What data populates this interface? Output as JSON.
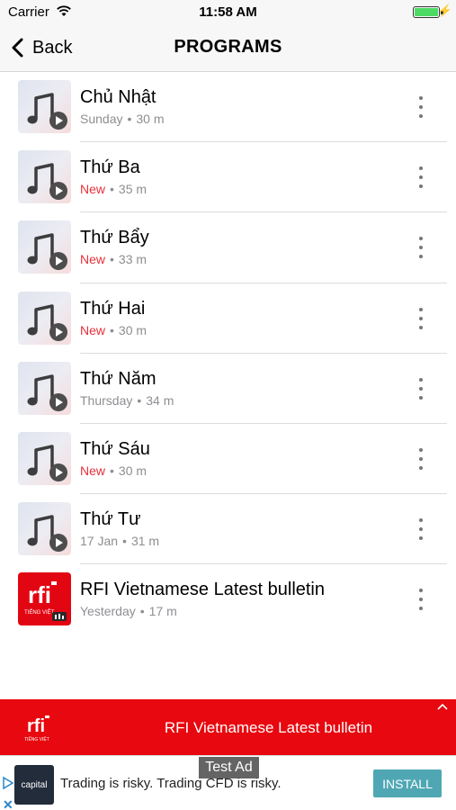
{
  "status_bar": {
    "carrier": "Carrier",
    "time": "11:58 AM"
  },
  "nav": {
    "back_label": "Back",
    "title": "PROGRAMS"
  },
  "programs": [
    {
      "title": "Chủ Nhật",
      "date": "Sunday",
      "is_new": false,
      "duration": "30 m",
      "thumb": "music-note-icon"
    },
    {
      "title": "Thứ Ba",
      "date": "New",
      "is_new": true,
      "duration": "35 m",
      "thumb": "music-note-icon"
    },
    {
      "title": "Thứ Bẩy",
      "date": "New",
      "is_new": true,
      "duration": "33 m",
      "thumb": "music-note-icon"
    },
    {
      "title": "Thứ Hai",
      "date": "New",
      "is_new": true,
      "duration": "30 m",
      "thumb": "music-note-icon"
    },
    {
      "title": "Thứ Năm",
      "date": "Thursday",
      "is_new": false,
      "duration": "34 m",
      "thumb": "music-note-icon"
    },
    {
      "title": "Thứ Sáu",
      "date": "New",
      "is_new": true,
      "duration": "30 m",
      "thumb": "music-note-icon"
    },
    {
      "title": "Thứ Tư",
      "date": "17 Jan",
      "is_new": false,
      "duration": "31 m",
      "thumb": "music-note-icon"
    },
    {
      "title": "RFI Vietnamese Latest bulletin",
      "date": "Yesterday",
      "is_new": false,
      "duration": "17 m",
      "thumb": "rfi-logo"
    }
  ],
  "mini_player": {
    "title": "RFI Vietnamese Latest bulletin",
    "logo_text": "rfi",
    "logo_subtext": "TIẾNG VIỆT"
  },
  "ad": {
    "label": "Test Ad",
    "logo_text": "capital",
    "text": "Trading is risky. Trading CFD is risky.",
    "install_label": "INSTALL"
  },
  "colors": {
    "accent_red": "#e8080f",
    "new_red": "#e5303a",
    "install_teal": "#4fa7b4",
    "battery_green": "#4cd964"
  }
}
